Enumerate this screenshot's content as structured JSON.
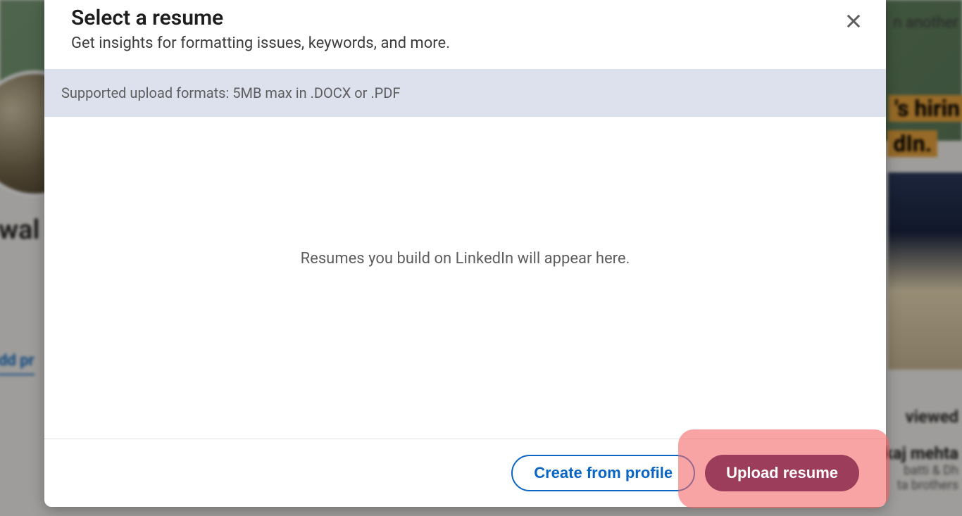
{
  "modal": {
    "title": "Select a resume",
    "subtitle": "Get insights for formatting issues, keywords, and more.",
    "info_bar": "Supported upload formats: 5MB max in .DOCX or .PDF",
    "empty_message": "Resumes you build on LinkedIn will appear here.",
    "create_from_profile_label": "Create from profile",
    "upload_resume_label": "Upload resume"
  },
  "background": {
    "name_fragment": "wal",
    "add_profile_fragment": "dd pr",
    "right_text1": "n another",
    "hiring_badge": "'s hirin",
    "dln_badge": "dIn.",
    "viewed": "viewed",
    "person1_name": "kaj mehta",
    "person1_sub1": "batti & Dh",
    "person1_sub2": "ta brothers"
  }
}
